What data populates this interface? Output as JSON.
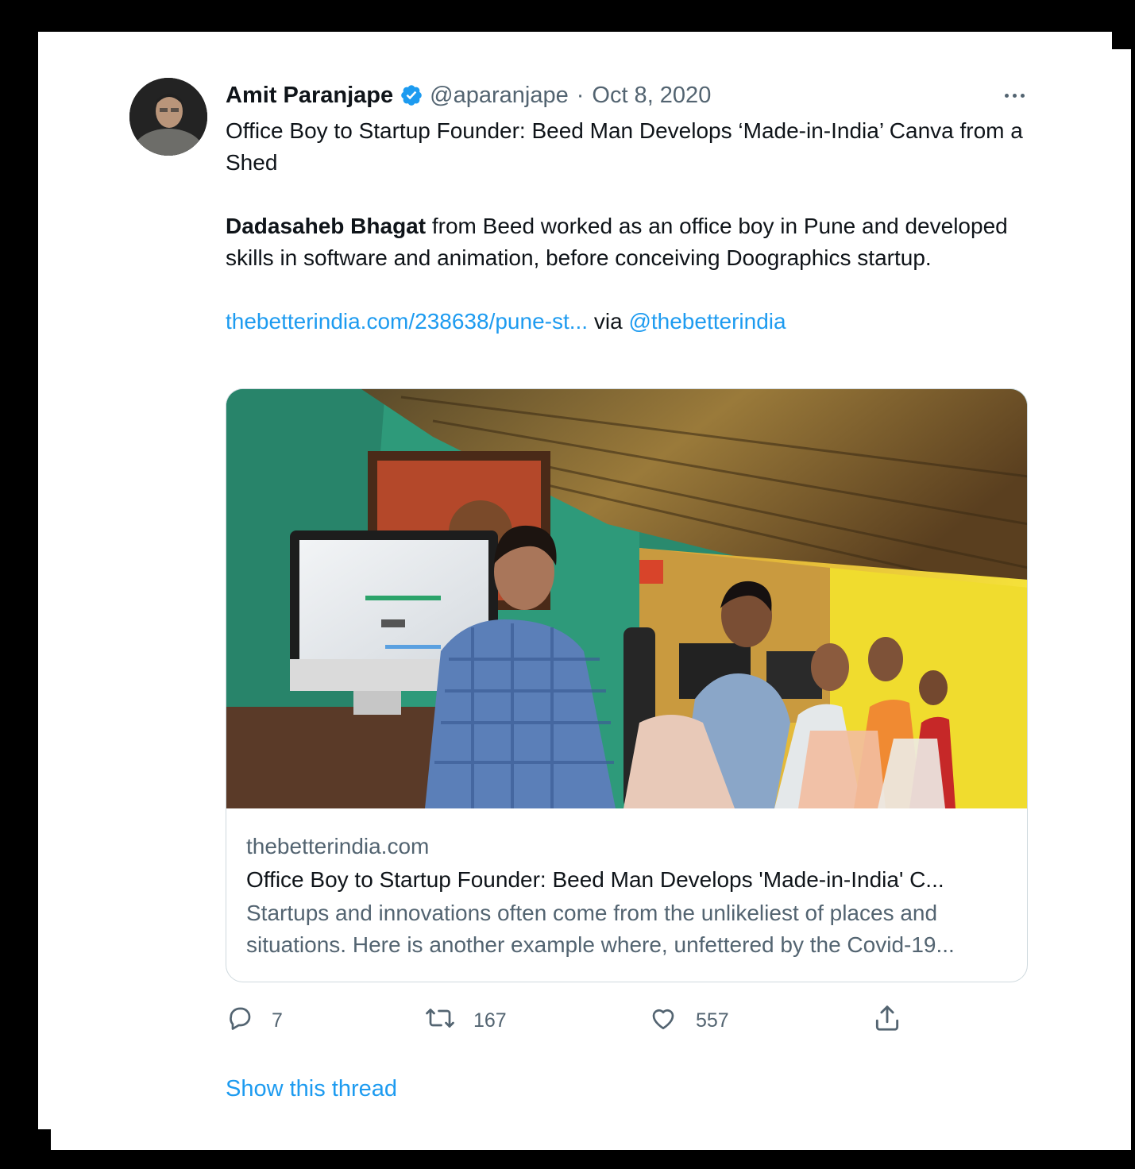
{
  "tweet": {
    "author_name": "Amit Paranjape",
    "handle": "@aparanjape",
    "separator": "·",
    "date": "Oct 8, 2020",
    "text_line1": "Office Boy to Startup Founder: Beed Man Develops ‘Made-in-India’ Canva from a Shed",
    "text_bold": "Dadasaheb Bhagat",
    "text_line2_rest": " from Beed worked as an office boy in Pune and developed skills in software and animation, before conceiving Doographics startup.",
    "link_text": "thebetterindia.com/238638/pune-st...",
    "via_text": " via ",
    "mention": "@thebetterindia"
  },
  "link_card": {
    "site": "thebetterindia.com",
    "title": "Office Boy to Startup Founder: Beed Man Develops 'Made-in-India' C...",
    "description": "Startups and innovations often come from the unlikeliest of places and situations. Here is another example where, unfettered by the Covid-19..."
  },
  "actions": {
    "replies": "7",
    "retweets": "167",
    "likes": "557"
  },
  "show_thread": "Show this thread",
  "icons": [
    "verified-badge-icon",
    "more-icon",
    "reply-icon",
    "retweet-icon",
    "like-icon",
    "share-icon"
  ],
  "colors": {
    "accent": "#1d9bf0",
    "secondary_text": "#536471",
    "primary_text": "#0f1419",
    "border": "#cfd9de"
  }
}
